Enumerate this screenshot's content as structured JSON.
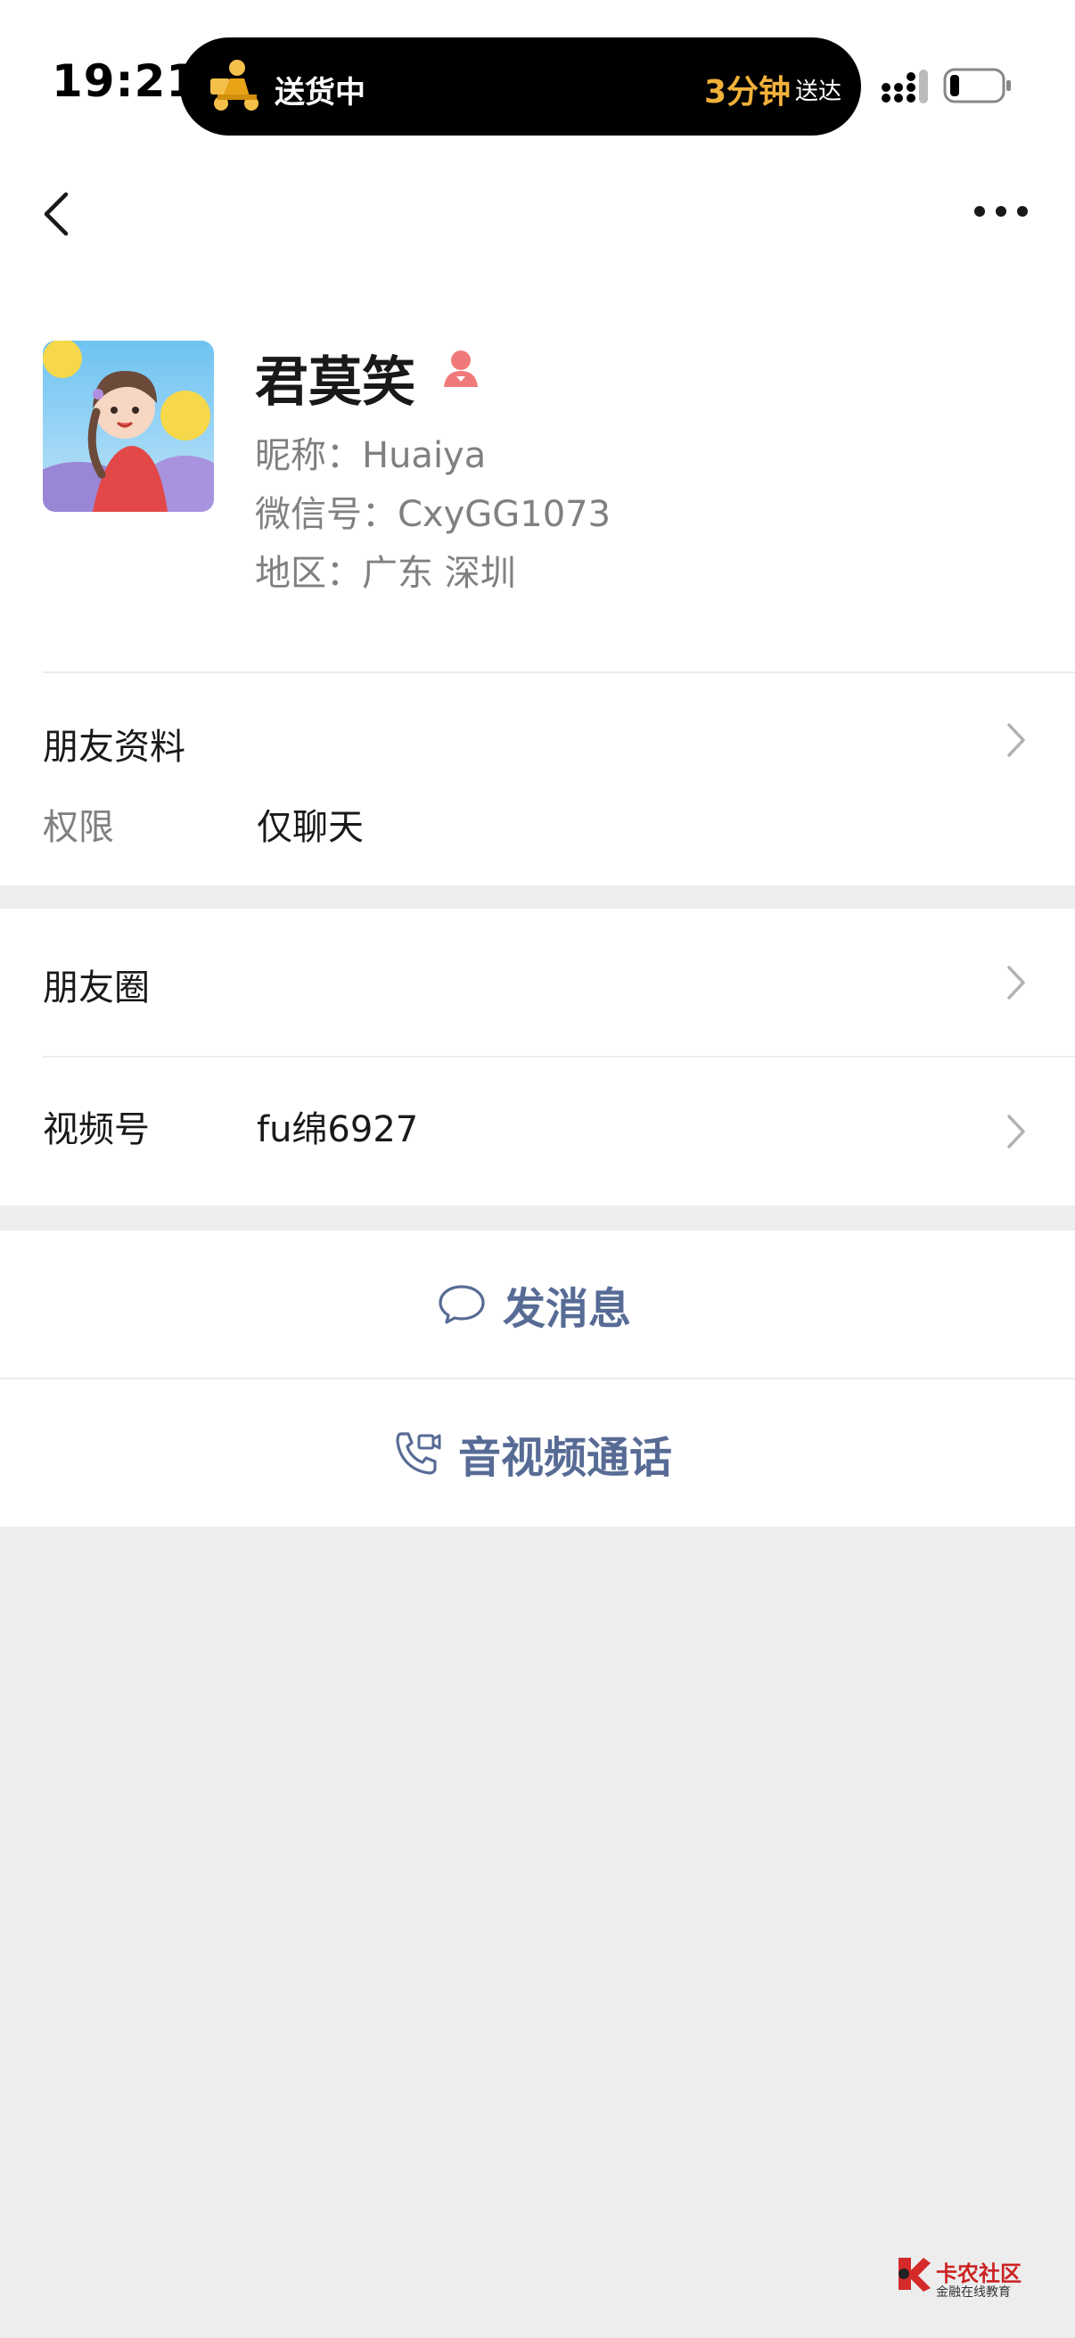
{
  "status_bar": {
    "time": "19:21",
    "island_status": "送货中",
    "island_eta": "3分钟",
    "island_eta_suffix": "送达"
  },
  "profile": {
    "name": "君莫笑",
    "gender": "female",
    "nickname_line": "昵称：Huaiya",
    "wechat_id_line": "微信号：CxyGG1073",
    "region_line": "地区：广东 深圳"
  },
  "friend_info": {
    "title": "朋友资料",
    "permission_label": "权限",
    "permission_value": "仅聊天"
  },
  "moments": {
    "title": "朋友圈"
  },
  "channels": {
    "title": "视频号",
    "value": "fu绵6927"
  },
  "actions": {
    "message": "发消息",
    "call": "音视频通话"
  },
  "watermark": {
    "line1": "卡农社区",
    "line2": "金融在线教育"
  },
  "colors": {
    "link": "#576b95",
    "background": "#ededed",
    "eta": "#f2b13a"
  }
}
